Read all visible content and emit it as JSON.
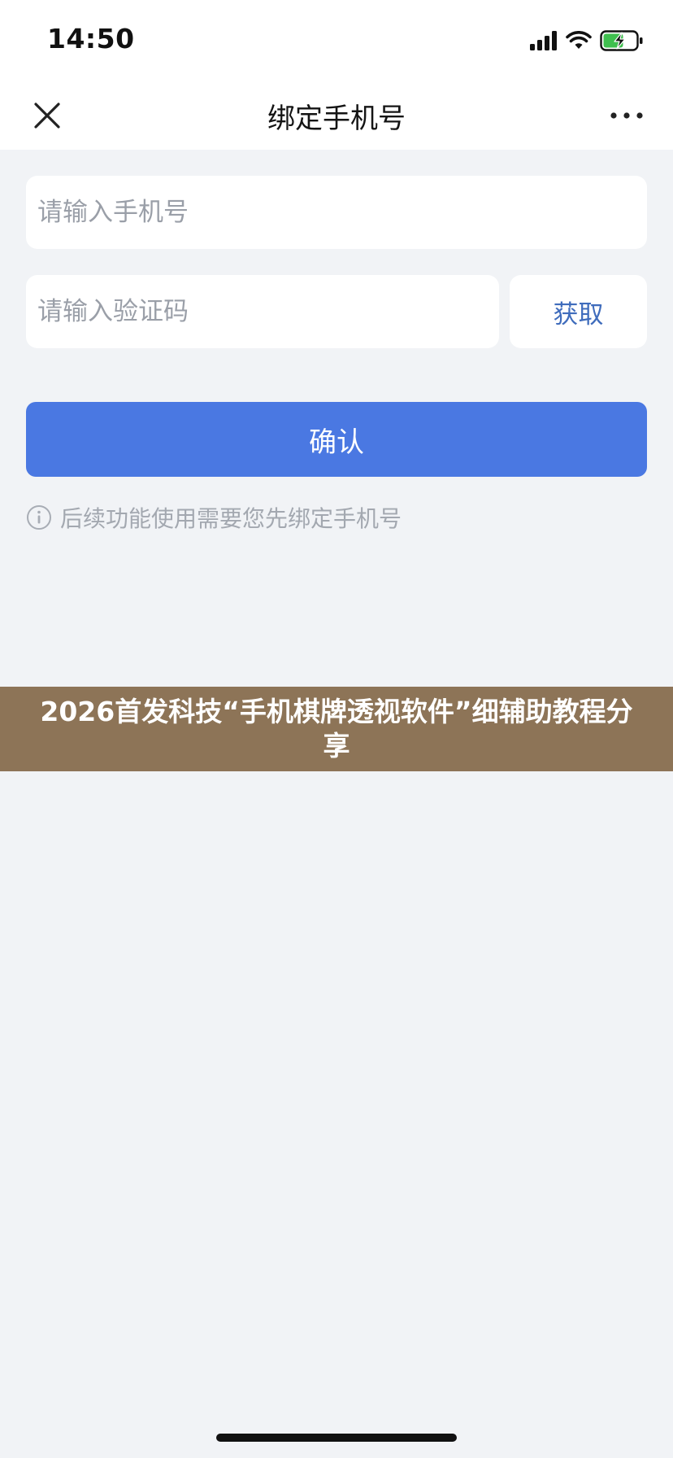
{
  "status_bar": {
    "time": "14:50",
    "signal_icon": "cellular-signal-icon",
    "wifi_icon": "wifi-icon",
    "battery_icon": "battery-charging-icon",
    "battery_color": "#3fbf4f"
  },
  "nav": {
    "close_icon": "close-icon",
    "title": "绑定手机号",
    "more_icon": "more-dots-icon"
  },
  "form": {
    "phone_placeholder": "请输入手机号",
    "phone_value": "",
    "code_placeholder": "请输入验证码",
    "code_value": "",
    "get_code_label": "获取",
    "confirm_label": "确认",
    "hint_icon": "info-icon",
    "hint_text": "后续功能使用需要您先绑定手机号"
  },
  "overlay": {
    "text": "2026首发科技“手机棋牌透视软件”细辅助教程分享"
  },
  "colors": {
    "background": "#f1f3f6",
    "primary_button": "#4a78e2",
    "link_text": "#3f6cbc",
    "overlay_banner": "#8d7457"
  }
}
